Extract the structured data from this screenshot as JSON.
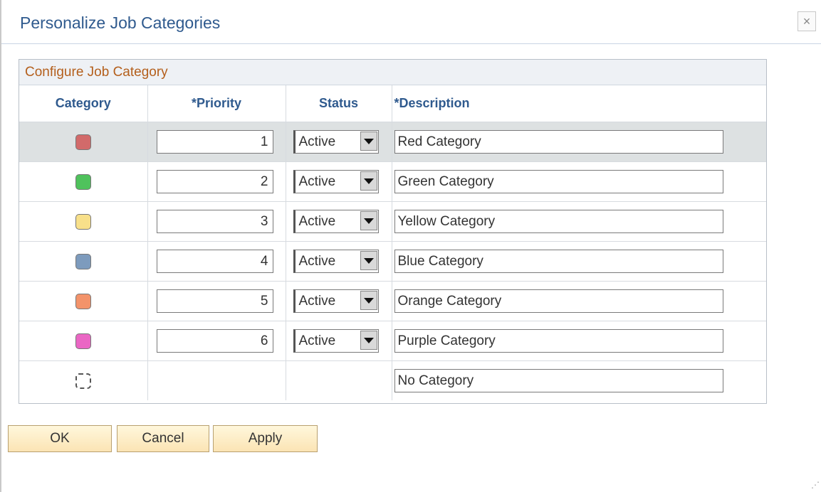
{
  "dialog": {
    "title": "Personalize Job Categories",
    "close_label": "×"
  },
  "grid": {
    "caption": "Configure Job Category",
    "columns": {
      "category": "Category",
      "priority": "*Priority",
      "status": "Status",
      "description": "*Description"
    },
    "rows": [
      {
        "color": "#d26a6a",
        "priority": "1",
        "status": "Active",
        "description": "Red Category"
      },
      {
        "color": "#4fc25c",
        "priority": "2",
        "status": "Active",
        "description": "Green Category"
      },
      {
        "color": "#f8e08a",
        "priority": "3",
        "status": "Active",
        "description": "Yellow Category"
      },
      {
        "color": "#7d9bbd",
        "priority": "4",
        "status": "Active",
        "description": "Blue Category"
      },
      {
        "color": "#f3936a",
        "priority": "5",
        "status": "Active",
        "description": "Orange Category"
      },
      {
        "color": "#ea66c4",
        "priority": "6",
        "status": "Active",
        "description": "Purple Category"
      },
      {
        "color": "",
        "priority": "",
        "status": "",
        "description": "No Category"
      }
    ],
    "selected_row": 0
  },
  "buttons": {
    "ok": "OK",
    "cancel": "Cancel",
    "apply": "Apply"
  },
  "colors": {
    "title": "#2f5a8e",
    "caption": "#b45f1c",
    "button_bg": "#fbe4b4"
  }
}
